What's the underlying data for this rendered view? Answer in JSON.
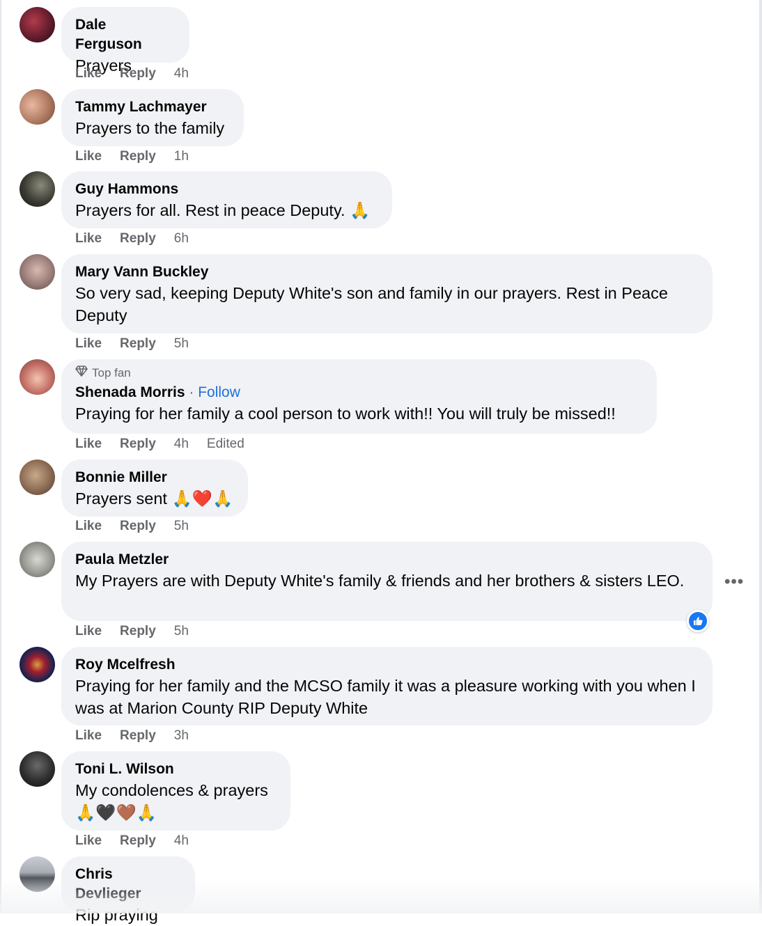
{
  "actions": {
    "like": "Like",
    "reply": "Reply"
  },
  "comments": [
    {
      "name": "Dale Ferguson",
      "text": "Prayers",
      "time": "4h"
    },
    {
      "name": "Tammy Lachmayer",
      "text": "Prayers to the family",
      "time": "1h"
    },
    {
      "name": "Guy Hammons",
      "text": "Prayers for all. Rest in peace Deputy. 🙏",
      "time": "6h"
    },
    {
      "name": "Mary Vann Buckley",
      "text": "So very sad, keeping Deputy White's son and family in our prayers. Rest in Peace Deputy",
      "time": "5h"
    },
    {
      "badge": "Top fan",
      "name": "Shenada Morris",
      "follow": "Follow",
      "text": "Praying for her family a cool person to work with!! You will truly be missed!!",
      "time": "4h",
      "edited": "Edited"
    },
    {
      "name": "Bonnie Miller",
      "text": "Prayers sent 🙏❤️🙏",
      "time": "5h"
    },
    {
      "name": "Paula Metzler",
      "text": "My Prayers are with Deputy White's family & friends and her brothers & sisters LEO.",
      "time": "5h"
    },
    {
      "name": "Roy Mcelfresh",
      "text": "Praying for her family and the MCSO family it was a pleasure working with you when I was at Marion County RIP Deputy White",
      "time": "3h"
    },
    {
      "name": "Toni L. Wilson",
      "text": "My condolences & prayers",
      "text2": "🙏🖤🤎🙏",
      "time": "4h"
    },
    {
      "name": "Chris Devlieger",
      "text": "Rip praying"
    }
  ],
  "icons": {
    "more": "more-options-icon",
    "like_reaction": "thumbs-up-icon",
    "top_fan": "diamond-icon"
  },
  "colors": {
    "bubble": "#f0f2f5",
    "meta": "#65676b",
    "link": "#216fdb",
    "like": "#1877f2"
  }
}
